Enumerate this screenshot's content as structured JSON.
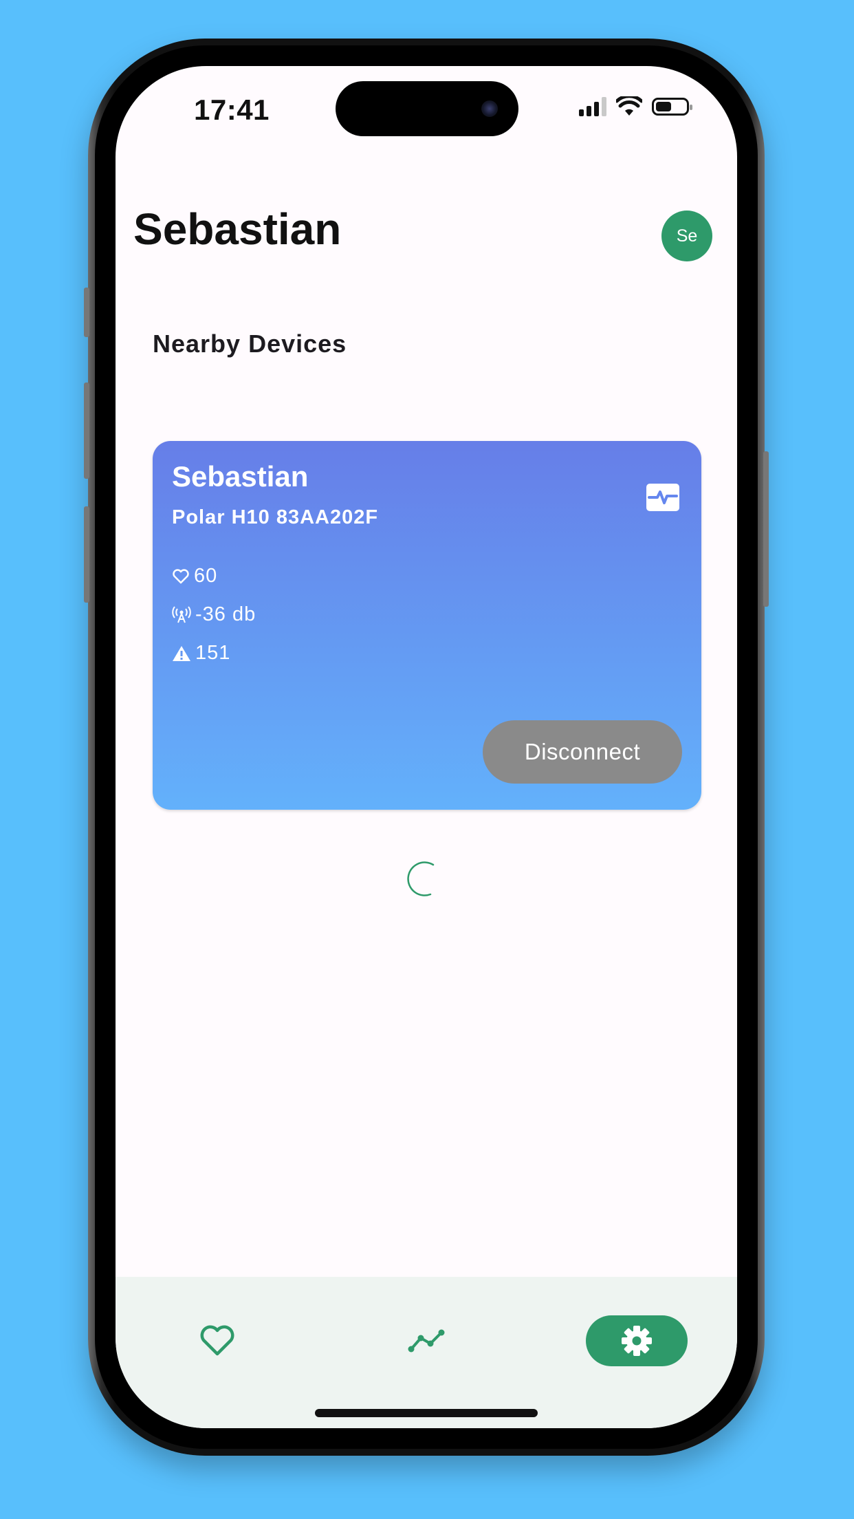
{
  "status_bar": {
    "time": "17:41"
  },
  "header": {
    "title": "Sebastian",
    "avatar_initials": "Se"
  },
  "section": {
    "title": "Nearby Devices"
  },
  "device_card": {
    "name": "Sebastian",
    "model": "Polar H10 83AA202F",
    "heart_rate": "60",
    "signal": "-36 db",
    "alerts": "151",
    "button_label": "Disconnect",
    "icon": "monitor-heart-icon"
  },
  "bottom_nav": {
    "items": [
      {
        "icon": "heart-icon",
        "active": false
      },
      {
        "icon": "trend-line-icon",
        "active": false
      },
      {
        "icon": "gear-icon",
        "active": true
      }
    ]
  },
  "colors": {
    "background": "#58BFFC",
    "accent": "#2E9A6A",
    "card_top": "#667EE8",
    "card_bottom": "#63B1FB",
    "button_gray": "#8A8A8A",
    "nav_bg": "#EEF4F1"
  }
}
